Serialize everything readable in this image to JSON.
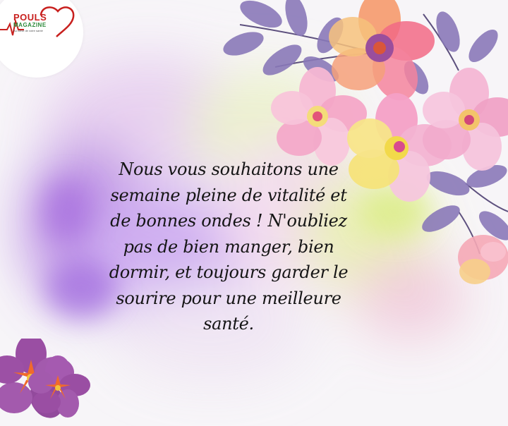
{
  "logo": {
    "name": "POULS",
    "subname": "MAGAZINE",
    "tagline": "Au cœur de votre santé"
  },
  "message": {
    "text": "Nous vous souhaitons une\nsemaine pleine de vitalité et\nde bonnes ondes ! N'oubliez\npas de bien manger, bien\ndormir, et toujours garder le\nsourire pour une meilleure\nsanté."
  },
  "colors": {
    "background": "#f7f5f8",
    "logo_red": "#c8201e",
    "logo_green": "#2e8b3c",
    "lavender_leaf": "#8a79b8",
    "pink_flower": "#f3a3c7",
    "purple_flower": "#9a4ea3",
    "orange_flower_center": "#f06a2c"
  },
  "decorations": [
    "watercolor-splash",
    "pink-flowers",
    "lavender-leaves",
    "purple-flowers"
  ]
}
